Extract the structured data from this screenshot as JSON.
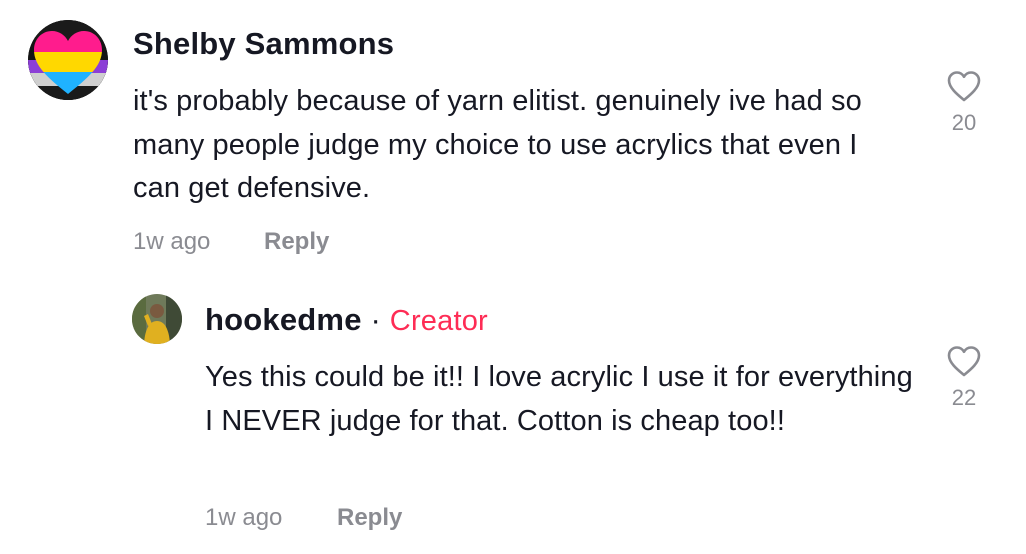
{
  "comments": [
    {
      "username": "Shelby Sammons",
      "text": "it's probably because of yarn elitist. genuinely ive had so many people judge my choice to use acrylics that even I can get defensive.",
      "time": "1w ago",
      "reply_label": "Reply",
      "like_count": "20",
      "avatar_icon": "pride-heart-avatar"
    },
    {
      "username": "hookedme",
      "separator": " · ",
      "badge": "Creator",
      "text": "Yes this could be it!! I love acrylic I use it for everything I NEVER judge for that. Cotton is cheap too!!",
      "time": "1w ago",
      "reply_label": "Reply",
      "like_count": "22",
      "avatar_icon": "user-photo-avatar"
    }
  ],
  "colors": {
    "text": "#161823",
    "muted": "#8a8b91",
    "creator_badge": "#fe2c55"
  }
}
